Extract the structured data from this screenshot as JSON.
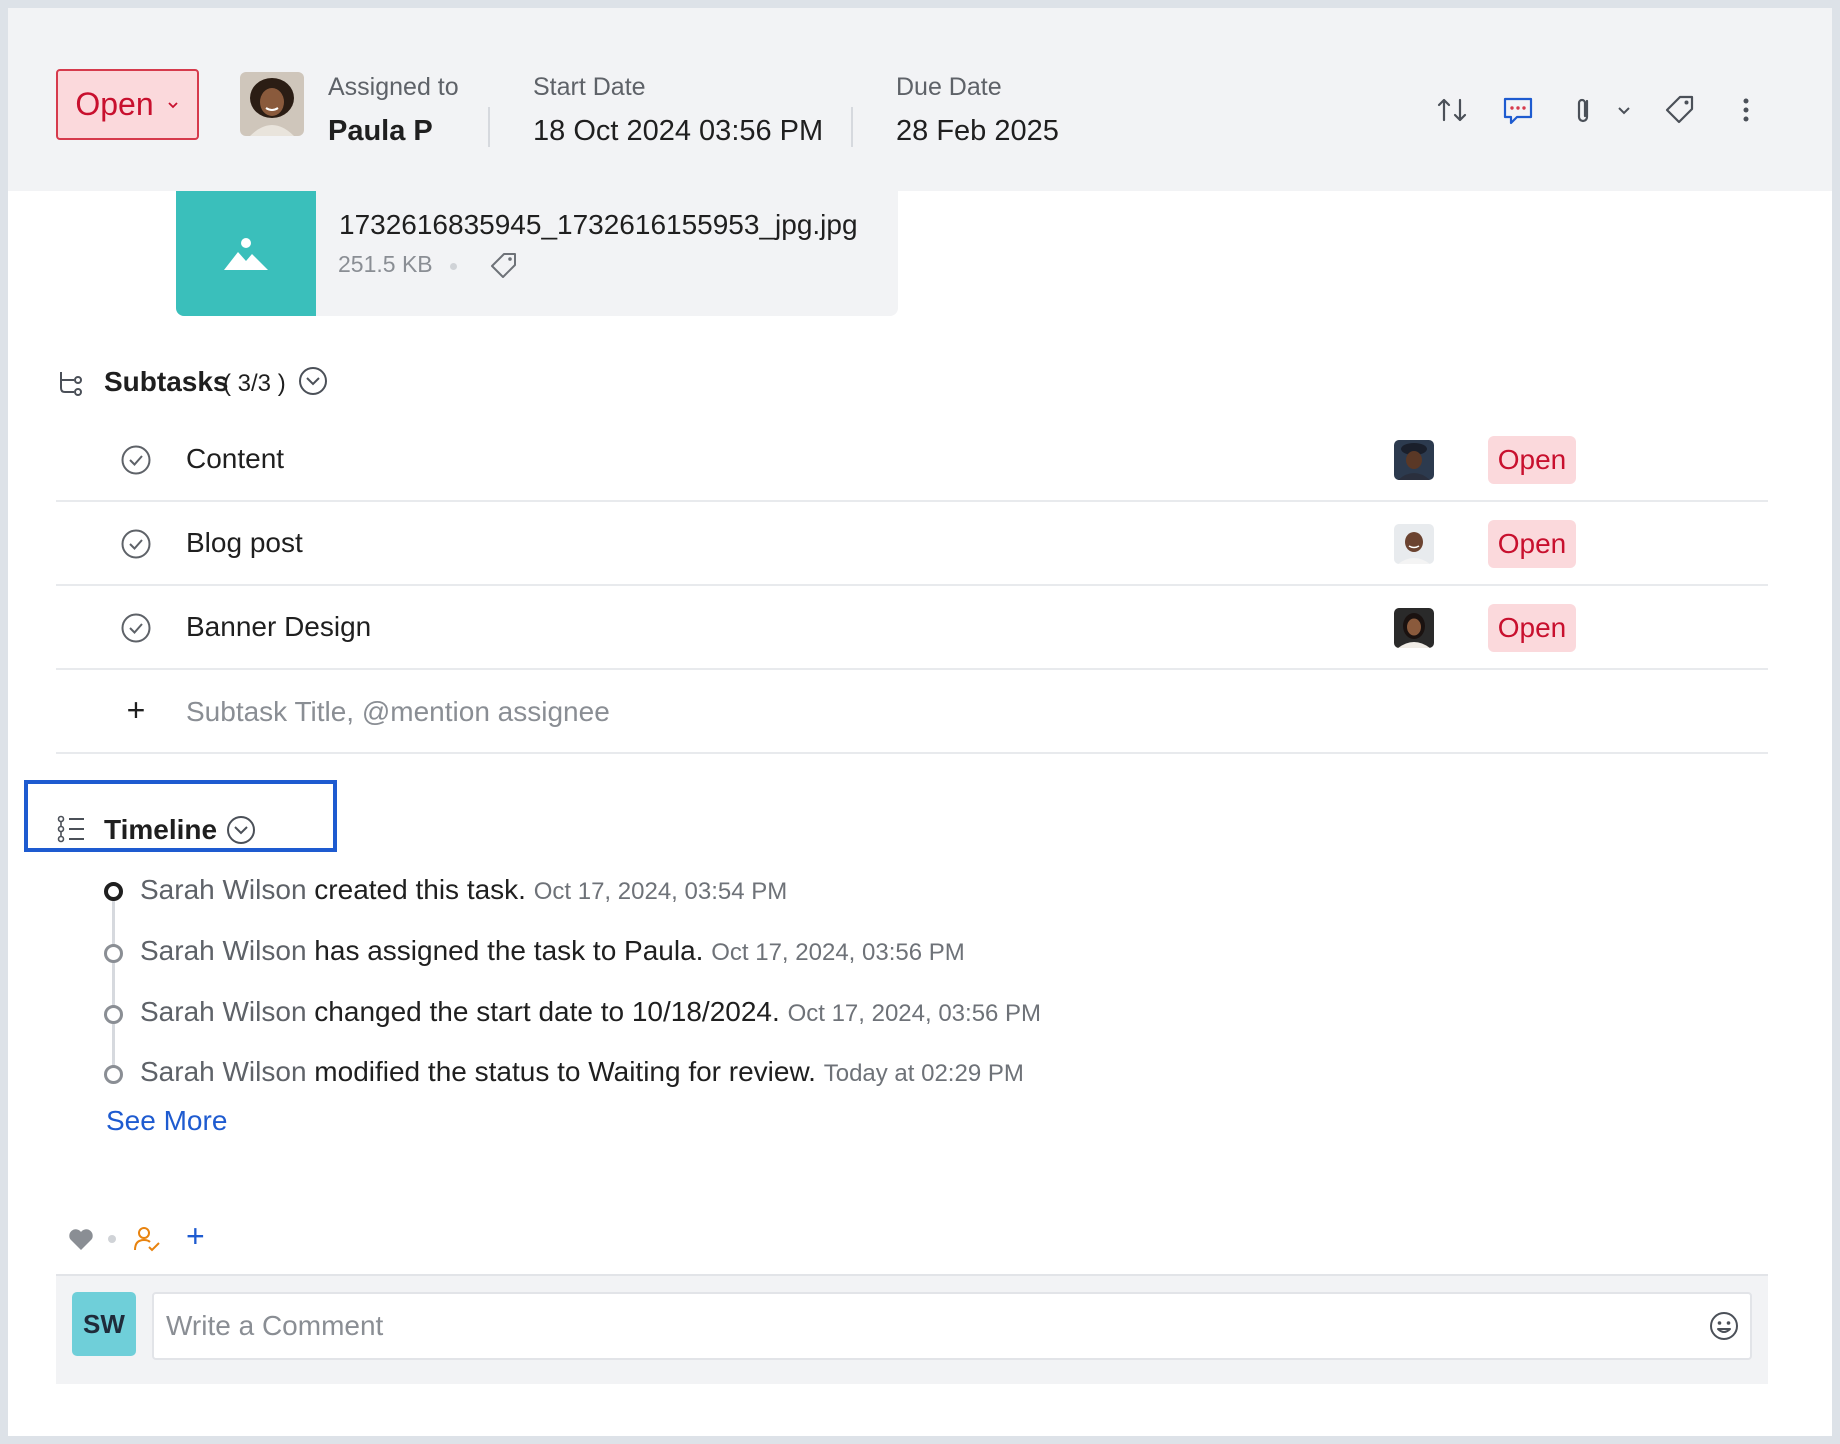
{
  "header": {
    "status": "Open",
    "assigned_label": "Assigned to",
    "assigned_value": "Paula P",
    "start_label": "Start Date",
    "start_value": "18 Oct 2024 03:56 PM",
    "due_label": "Due Date",
    "due_value": "28 Feb 2025",
    "icons": [
      "reorder-icon",
      "comment-icon",
      "paperclip-icon",
      "chevron-down-icon",
      "tag-icon",
      "more-vertical-icon"
    ]
  },
  "attachment": {
    "file_name": "1732616835945_1732616155953_jpg.jpg",
    "file_size": "251.5 KB",
    "icon": "image-icon"
  },
  "subtasks": {
    "title": "Subtasks",
    "count": "( 3/3 )",
    "items": [
      {
        "title": "Content",
        "status": "Open"
      },
      {
        "title": "Blog post",
        "status": "Open"
      },
      {
        "title": "Banner Design",
        "status": "Open"
      }
    ],
    "add_placeholder": "Subtask Title, @mention assignee"
  },
  "timeline": {
    "title": "Timeline",
    "entries": [
      {
        "actor": "Sarah Wilson",
        "action": "created this task.",
        "time": "Oct 17, 2024, 03:54 PM"
      },
      {
        "actor": "Sarah Wilson",
        "action": "has assigned the task to Paula.",
        "time": "Oct 17, 2024, 03:56 PM"
      },
      {
        "actor": "Sarah Wilson",
        "action": "changed the start date to 10/18/2024.",
        "time": "Oct 17, 2024, 03:56 PM"
      },
      {
        "actor": "Sarah Wilson",
        "action": "modified the status to Waiting for review.",
        "time": "Today at 02:29 PM"
      }
    ],
    "see_more": "See More"
  },
  "comment": {
    "avatar_initials": "SW",
    "placeholder": "Write a Comment"
  },
  "colors": {
    "accent": "#1e5bd0",
    "status_bg": "#fbd9dc",
    "status_text": "#c8102e",
    "attachment_thumb": "#3abfbb"
  }
}
